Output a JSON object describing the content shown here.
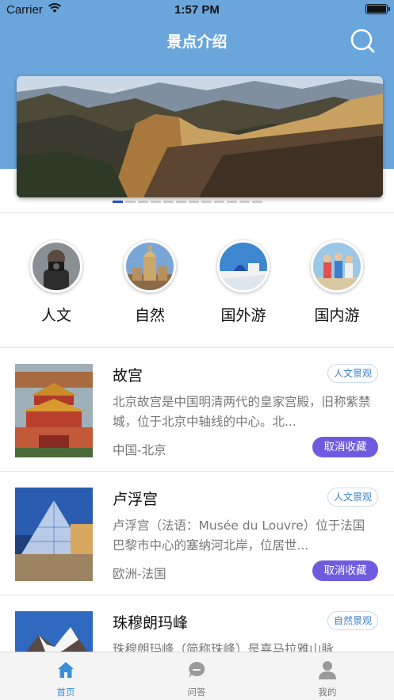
{
  "status_bar": {
    "carrier": "Carrier",
    "time": "1:57 PM"
  },
  "nav": {
    "title": "景点介绍"
  },
  "banner": {
    "page_count": 12,
    "active_page": 1
  },
  "categories": [
    {
      "label": "人文"
    },
    {
      "label": "自然"
    },
    {
      "label": "国外游"
    },
    {
      "label": "国内游"
    }
  ],
  "attractions": [
    {
      "name": "故宫",
      "tag": "人文景观",
      "desc": "北京故宫是中国明清两代的皇家宫殿，旧称紫禁城，位于北京中轴线的中心。北...",
      "location": "中国-北京",
      "action": "取消收藏"
    },
    {
      "name": "卢浮宫",
      "tag": "人文景观",
      "desc": "卢浮宫（法语：Musée du Louvre）位于法国巴黎市中心的塞纳河北岸，位居世...",
      "location": "欧洲-法国",
      "action": "取消收藏"
    },
    {
      "name": "珠穆朗玛峰",
      "tag": "自然景观",
      "desc": "珠穆朗玛峰（简称珠峰）是喜马拉雅山脉",
      "location": "",
      "action": ""
    }
  ],
  "tabs": [
    {
      "label": "首页",
      "icon": "home-icon",
      "active": true
    },
    {
      "label": "问答",
      "icon": "chat-icon",
      "active": false
    },
    {
      "label": "我的",
      "icon": "person-icon",
      "active": false
    }
  ],
  "colors": {
    "header": "#6aa6dc",
    "accent": "#6f5be0",
    "tab_active": "#3a8fd8",
    "dot_active": "#2b4fc8"
  }
}
